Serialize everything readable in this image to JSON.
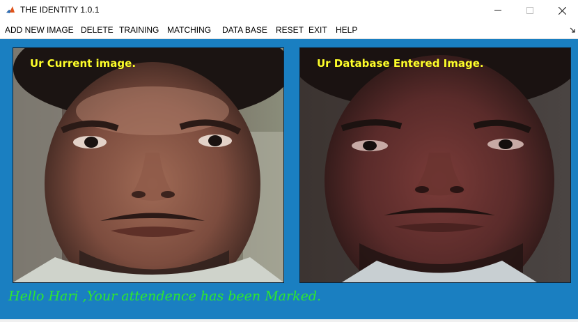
{
  "window": {
    "title": "THE IDENTITY 1.0.1",
    "app_icon": "matlab-icon",
    "controls": {
      "minimize_icon": "minimize-icon",
      "maximize_icon": "maximize-icon",
      "close_icon": "close-icon"
    }
  },
  "menu": {
    "items": [
      {
        "label": "ADD NEW IMAGE"
      },
      {
        "label": "DELETE"
      },
      {
        "label": "TRAINING"
      },
      {
        "label": "MATCHING"
      },
      {
        "label": "DATA BASE"
      },
      {
        "label": "RESET"
      },
      {
        "label": "EXIT"
      },
      {
        "label": "HELP"
      }
    ],
    "corner_icon": "dock-arrow-icon"
  },
  "panels": {
    "current": {
      "caption": "Ur Current image."
    },
    "database": {
      "caption": "Ur Database Entered Image."
    }
  },
  "status": {
    "message": "Hello Hari ,Your attendence has been Marked."
  },
  "colors": {
    "figure_background": "#1a7fc1",
    "caption_color": "#ffff2a",
    "status_color": "#2ee82e"
  }
}
